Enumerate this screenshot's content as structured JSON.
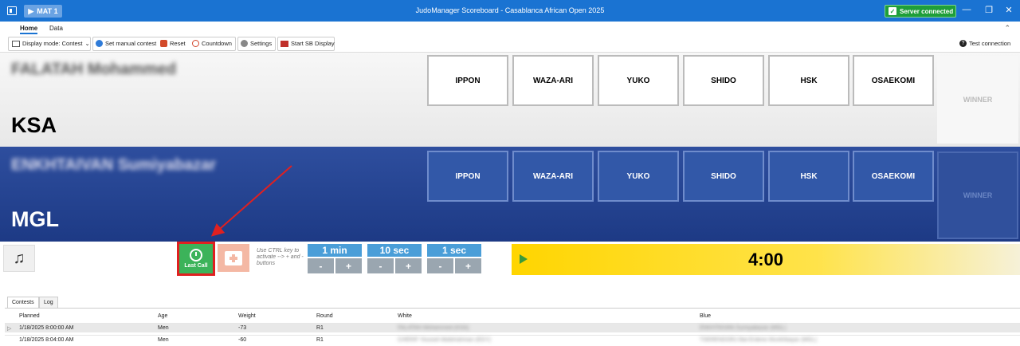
{
  "titlebar": {
    "mat_label": "MAT 1",
    "title": "JudoManager Scoreboard - Casablanca African Open 2025",
    "server_status": "Server connected"
  },
  "ribbon": {
    "tabs": [
      "Home",
      "Data"
    ],
    "display_mode": "Display mode: Contest",
    "set_manual_contest": "Set manual contest",
    "reset": "Reset",
    "countdown": "Countdown",
    "settings": "Settings",
    "start_sb_display": "Start SB Display",
    "test_connection": "Test connection"
  },
  "white": {
    "name": "FALATAH Mohammed",
    "country": "KSA",
    "scores": [
      "IPPON",
      "WAZA-ARI",
      "YUKO",
      "SHIDO",
      "HSK",
      "OSAEKOMI"
    ],
    "winner": "WINNER"
  },
  "blue": {
    "name": "ENKHTAIVAN Sumiyabazar",
    "country": "MGL",
    "scores": [
      "IPPON",
      "WAZA-ARI",
      "YUKO",
      "SHIDO",
      "HSK",
      "OSAEKOMI"
    ],
    "winner": "WINNER"
  },
  "controls": {
    "last_call": "Last Call",
    "hint": "Use CTRL key to activate --> + and - buttons",
    "adjust": [
      {
        "label": "1 min",
        "minus": "-",
        "plus": "+"
      },
      {
        "label": "10 sec",
        "minus": "-",
        "plus": "+"
      },
      {
        "label": "1 sec",
        "minus": "-",
        "plus": "+"
      }
    ],
    "time": "4:00"
  },
  "lower_tabs": [
    "Contests",
    "Log"
  ],
  "table": {
    "columns": [
      "Planned",
      "Age",
      "Weight",
      "Round",
      "White",
      "Blue"
    ],
    "rows": [
      {
        "planned": "1/18/2025 8:00:00 AM",
        "age": "Men",
        "weight": "-73",
        "round": "R1",
        "white": "FALATAH Mohammed (KSA)",
        "blue": "ENKHTAIVAN Sumiyabazar (MGL)"
      },
      {
        "planned": "1/18/2025 8:04:00 AM",
        "age": "Men",
        "weight": "-60",
        "round": "R1",
        "white": "CHERIF Youssef Abdelrahman (EGY)",
        "blue": "TSERENDORJ Bat-Erdene Munkhbayar (MGL)"
      }
    ]
  },
  "colors": {
    "titlebar": "#1a73d2",
    "blue_panel": "#1d3a85",
    "timer": "#ffd500",
    "last_call": "#3cb35a",
    "highlight": "#e02020"
  }
}
